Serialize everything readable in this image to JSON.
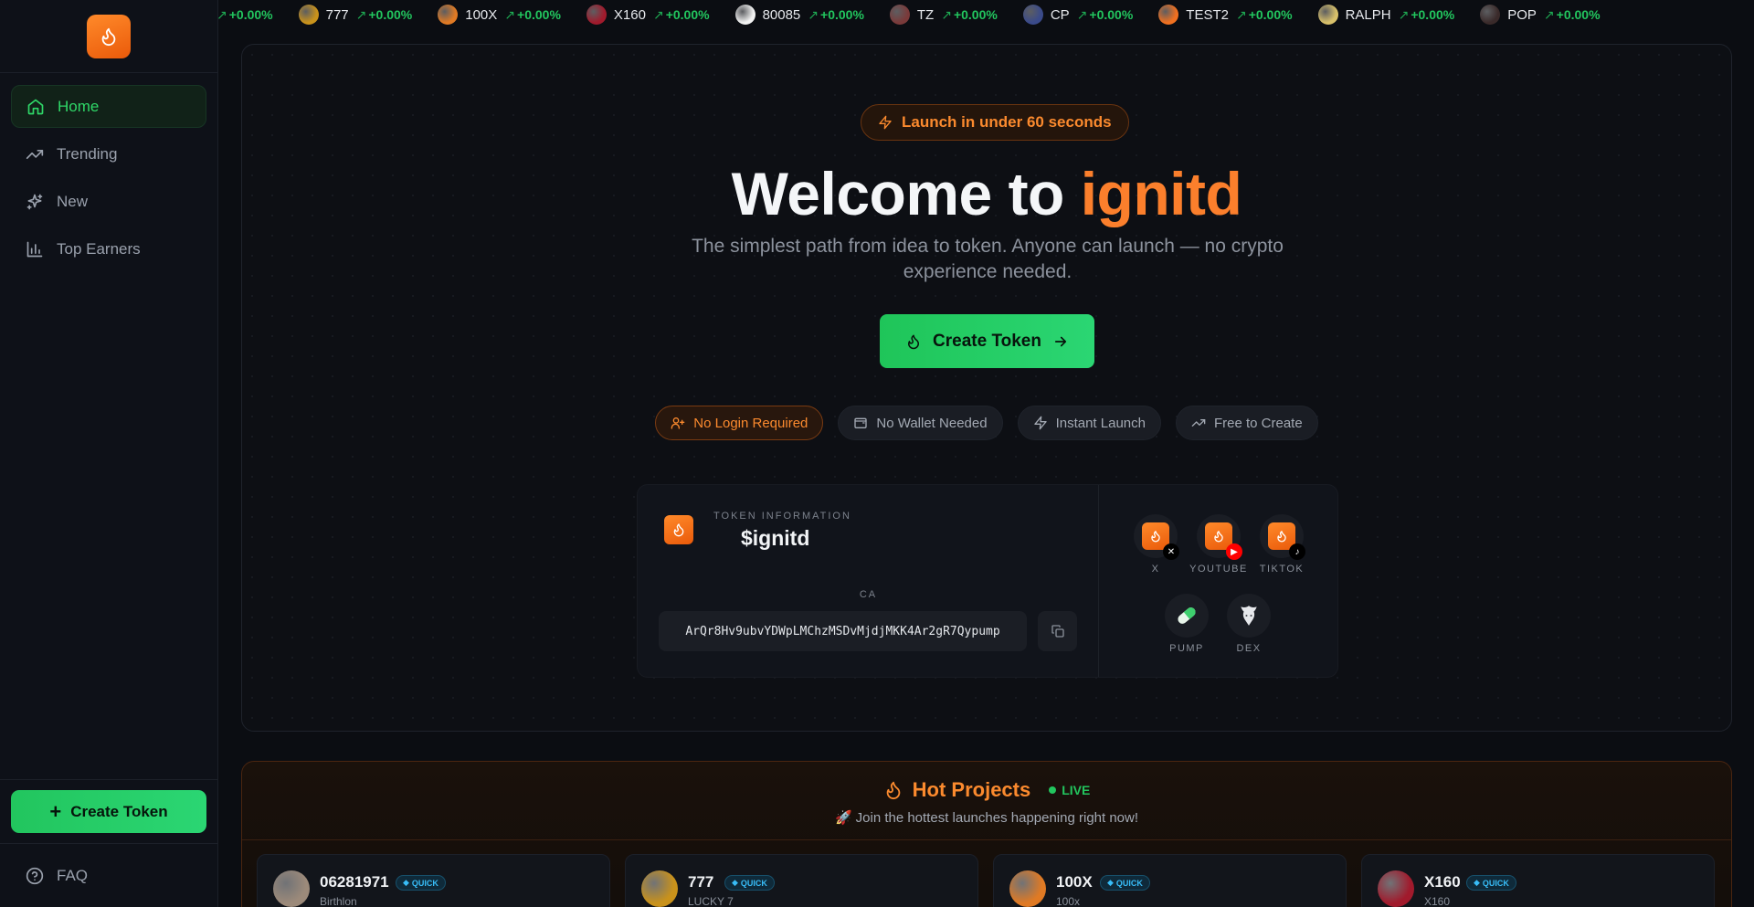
{
  "ticker": [
    {
      "symbol": "",
      "change": "+0.00%",
      "color": "#e08a1c"
    },
    {
      "symbol": "777",
      "change": "+0.00%",
      "color": "#c9921b"
    },
    {
      "symbol": "100X",
      "change": "+0.00%",
      "color": "#e07a24"
    },
    {
      "symbol": "X160",
      "change": "+0.00%",
      "color": "#a11a2c"
    },
    {
      "symbol": "80085",
      "change": "+0.00%",
      "color": "#f2f2f2"
    },
    {
      "symbol": "TZ",
      "change": "+0.00%",
      "color": "#7a3a3a"
    },
    {
      "symbol": "CP",
      "change": "+0.00%",
      "color": "#3a4a8a"
    },
    {
      "symbol": "TEST2",
      "change": "+0.00%",
      "color": "#f07020"
    },
    {
      "symbol": "RALPH",
      "change": "+0.00%",
      "color": "#d8c06a"
    },
    {
      "symbol": "POP",
      "change": "+0.00%",
      "color": "#3a2a2a"
    }
  ],
  "sidebar": {
    "items": [
      {
        "label": "Home"
      },
      {
        "label": "Trending"
      },
      {
        "label": "New"
      },
      {
        "label": "Top Earners"
      }
    ],
    "create_label": "Create Token",
    "faq_label": "FAQ"
  },
  "hero": {
    "pill": "Launch in under 60 seconds",
    "title_prefix": "Welcome to ",
    "title_brand": "ignitd",
    "subtitle": "The simplest path from idea to token. Anyone can launch — no crypto experience needed.",
    "cta": "Create Token",
    "chips": [
      "No Login Required",
      "No Wallet Needed",
      "Instant Launch",
      "Free to Create"
    ]
  },
  "token": {
    "label": "TOKEN INFORMATION",
    "name": "$ignitd",
    "ca_label": "CA",
    "ca": "ArQr8Hv9ubvYDWpLMChzMSDvMjdjMKK4Ar2gR7Qypump",
    "socials": [
      "X",
      "YOUTUBE",
      "TIKTOK",
      "PUMP",
      "DEX"
    ]
  },
  "hot": {
    "title": "Hot Projects",
    "live": "LIVE",
    "subtitle": "Join the hottest launches happening right now!",
    "quick_label": "QUICK",
    "projects": [
      {
        "name": "06281971",
        "sub": "Birthlon",
        "color": "#9c8a7a"
      },
      {
        "name": "777",
        "sub": "LUCKY 7",
        "color": "#c9921b"
      },
      {
        "name": "100X",
        "sub": "100x",
        "color": "#e07a24"
      },
      {
        "name": "X160",
        "sub": "X160",
        "color": "#a11a2c"
      }
    ]
  },
  "colors": {
    "accent_orange": "#fb7f2c",
    "accent_green": "#22c55e",
    "bg": "#0b0d12"
  }
}
